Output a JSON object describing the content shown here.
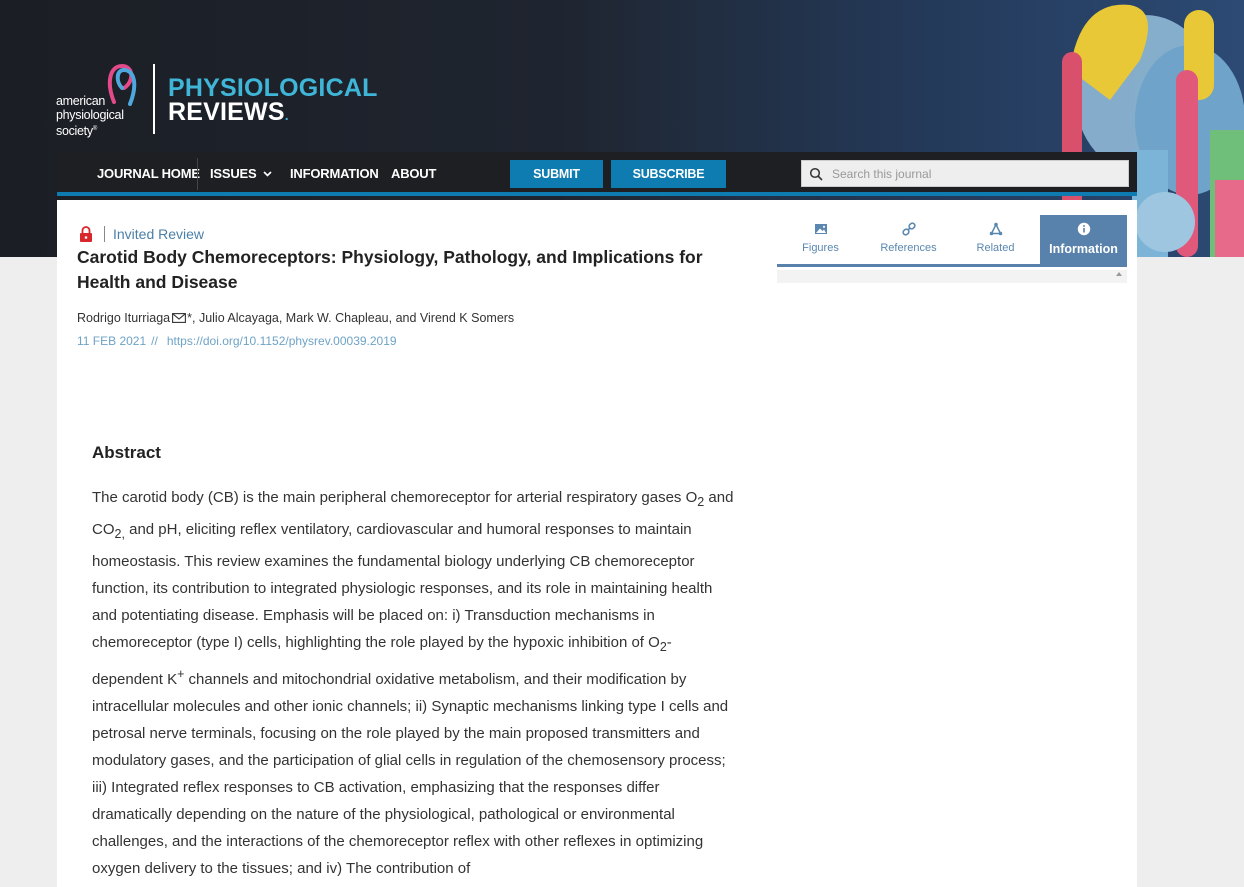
{
  "brand": {
    "society_lines": [
      "american",
      "physiological",
      "society"
    ],
    "society_mark": "®",
    "journal_line1": "PHYSIOLOGICAL",
    "journal_line2": "REVIEWS",
    "journal_mark": "."
  },
  "nav": {
    "journal_home": "JOURNAL HOME",
    "issues": "ISSUES",
    "information": "INFORMATION",
    "about": "ABOUT",
    "submit": "SUBMIT",
    "subscribe": "SUBSCRIBE",
    "search_placeholder": "Search this journal"
  },
  "article": {
    "type": "Invited Review",
    "title": "Carotid Body Chemoreceptors: Physiology, Pathology, and Implications for Health and Disease",
    "authors": {
      "first": "Rodrigo Iturriaga",
      "first_mark": "*,",
      "others": "Julio Alcayaga, Mark W. Chapleau,",
      "conj": "and",
      "last": "Virend K Somers"
    },
    "date": "11 FEB 2021",
    "sep": "//",
    "doi": "https://doi.org/10.1152/physrev.00039.2019"
  },
  "abstract": {
    "heading": "Abstract",
    "t1": "The carotid body (CB) is the main peripheral chemoreceptor for arterial respiratory gases O",
    "sub1": "2",
    "t2": " and CO",
    "sub2": "2,",
    "t3": " and pH, eliciting reflex ventilatory, cardiovascular and humoral responses to maintain homeostasis. This review examines the fundamental biology underlying CB chemoreceptor function, its contribution to integrated physiologic responses, and its role in maintaining health and potentiating disease. Emphasis will be placed on: i) Transduction mechanisms in chemoreceptor (type I) cells, highlighting the role played by the hypoxic inhibition of O",
    "sub3": "2",
    "t4": "-dependent K",
    "sup1": "+",
    "t5": " channels and mitochondrial oxidative metabolism, and their modification by intracellular molecules and other ionic channels; ii) Synaptic mechanisms linking type I cells and petrosal nerve terminals, focusing on the role played by the main proposed transmitters and modulatory gases, and the participation of glial cells in regulation of the chemosensory process; iii) Integrated reflex responses to CB activation, emphasizing that the responses differ dramatically depending on the nature of the physiological, pathological or environmental challenges, and the interactions of the chemoreceptor reflex with other reflexes in optimizing oxygen delivery to the tissues; and iv) The contribution of"
  },
  "tabs": [
    {
      "label": "Figures",
      "icon": "image-icon"
    },
    {
      "label": "References",
      "icon": "link-icon"
    },
    {
      "label": "Related",
      "icon": "network-icon"
    },
    {
      "label": "Information",
      "icon": "info-icon",
      "active": true
    }
  ],
  "colors": {
    "accent": "#0e7cb0",
    "tab_active": "#5882ab",
    "link": "#6ea3c6",
    "lock": "#d9262c"
  }
}
